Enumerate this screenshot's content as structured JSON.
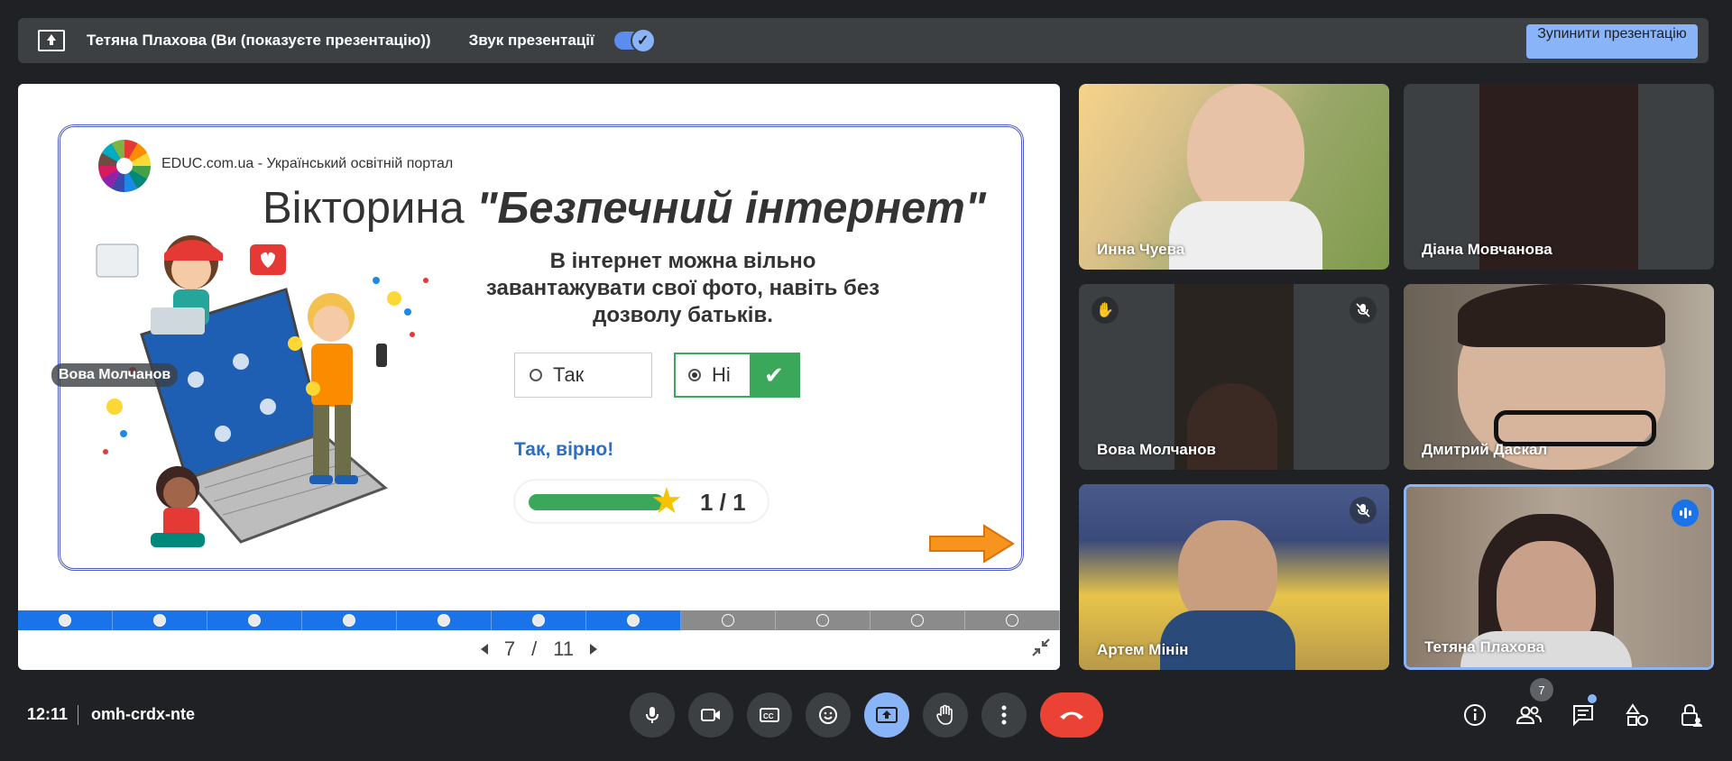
{
  "topbar": {
    "presenter": "Тетяна Плахова (Ви (показуєте презентацію))",
    "sound_label": "Звук презентації",
    "stop_button": "Зупинити презентацію"
  },
  "slide": {
    "portal": "EDUC.com.ua - Український освітній портал",
    "title_plain": "Вікторина",
    "title_quoted": "\"Безпечний інтернет\"",
    "question": "В інтернет можна вільно завантажувати свої фото, навіть без дозволу батьків.",
    "answers": [
      {
        "label": "Так",
        "selected": false
      },
      {
        "label": "Ні",
        "selected": true,
        "correct": true
      }
    ],
    "feedback": "Так, вірно!",
    "score": "1 / 1",
    "progress_fraction": 1.0,
    "overlay_name": "Вова Молчанов",
    "page_current": "7",
    "page_sep": "/",
    "page_total": "11",
    "dots_total": 11,
    "dots_done": 7
  },
  "participants": [
    {
      "name": "Инна Чуева",
      "muted": false
    },
    {
      "name": "Діана Мовчанова",
      "muted": false
    },
    {
      "name": "Вова Молчанов",
      "muted": true,
      "hand": true
    },
    {
      "name": "Дмитрий Даскал",
      "muted": false
    },
    {
      "name": "Артем Мінін",
      "muted": true
    },
    {
      "name": "Тетяна Плахова",
      "speaking": true
    }
  ],
  "bottombar": {
    "time": "12:11",
    "meeting_code": "omh-crdx-nte",
    "people_count": "7"
  },
  "colors": {
    "accent": "#8ab4f8",
    "end_call": "#ea4335",
    "correct_green": "#3aa75a",
    "dot_blue": "#1a73e8"
  }
}
